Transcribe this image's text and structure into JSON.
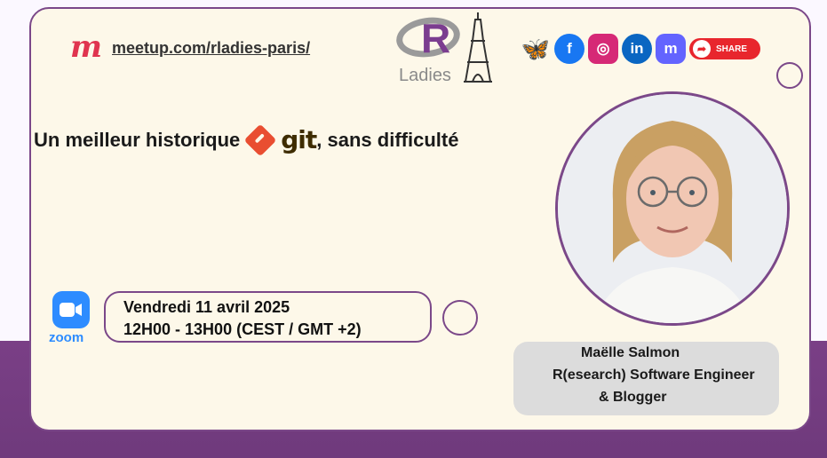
{
  "meetup": {
    "logo_letter": "m",
    "url": "meetup.com/rladies-paris/"
  },
  "logo": {
    "letter": "R",
    "word": "Ladies"
  },
  "socials": [
    {
      "name": "bluesky",
      "glyph": "🦋",
      "color": "#1185fe"
    },
    {
      "name": "facebook",
      "glyph": "f",
      "color": "#1877f2"
    },
    {
      "name": "instagram",
      "glyph": "◎",
      "color": "#d62976"
    },
    {
      "name": "linkedin",
      "glyph": "in",
      "color": "#0a66c2"
    },
    {
      "name": "mastodon",
      "glyph": "m",
      "color": "#6364ff"
    }
  ],
  "share_label": "SHARE",
  "title": {
    "before": "Un meilleur historique",
    "git": "git",
    "after": ", sans difficulté"
  },
  "event": {
    "platform_label": "zoom",
    "date": "Vendredi 11 avril 2025",
    "time": "12H00 - 13H00 (CEST / GMT +2)"
  },
  "speaker": {
    "name": "Maëlle Salmon",
    "role_line1": "R(esearch) Software Engineer",
    "role_line2": "& Blogger"
  },
  "colors": {
    "accent": "#7b4889",
    "card": "#fdf8e9",
    "band": "#7a3f86"
  }
}
